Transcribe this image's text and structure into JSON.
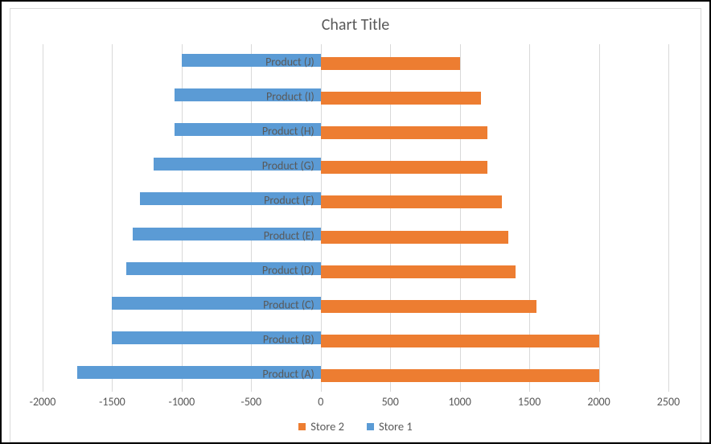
{
  "chart_data": {
    "type": "bar",
    "orientation": "horizontal",
    "title": "Chart Title",
    "xlabel": "",
    "ylabel": "",
    "xlim": [
      -2000,
      2500
    ],
    "xticks": [
      -2000,
      -1500,
      -1000,
      -500,
      0,
      500,
      1000,
      1500,
      2000,
      2500
    ],
    "categories": [
      "Product (A)",
      "Product (B)",
      "Product (C)",
      "Product (D)",
      "Product (E)",
      "Product (F)",
      "Product (G)",
      "Product (H)",
      "Product (I)",
      "Product (J)"
    ],
    "series": [
      {
        "name": "Store 2",
        "color": "#ed7d31",
        "values": [
          2000,
          2000,
          1550,
          1400,
          1350,
          1300,
          1200,
          1200,
          1150,
          1000
        ]
      },
      {
        "name": "Store 1",
        "color": "#5b9bd5",
        "values": [
          -1750,
          -1500,
          -1500,
          -1400,
          -1350,
          -1300,
          -1200,
          -1050,
          -1050,
          -1000
        ]
      }
    ],
    "legend": {
      "position": "bottom"
    }
  }
}
